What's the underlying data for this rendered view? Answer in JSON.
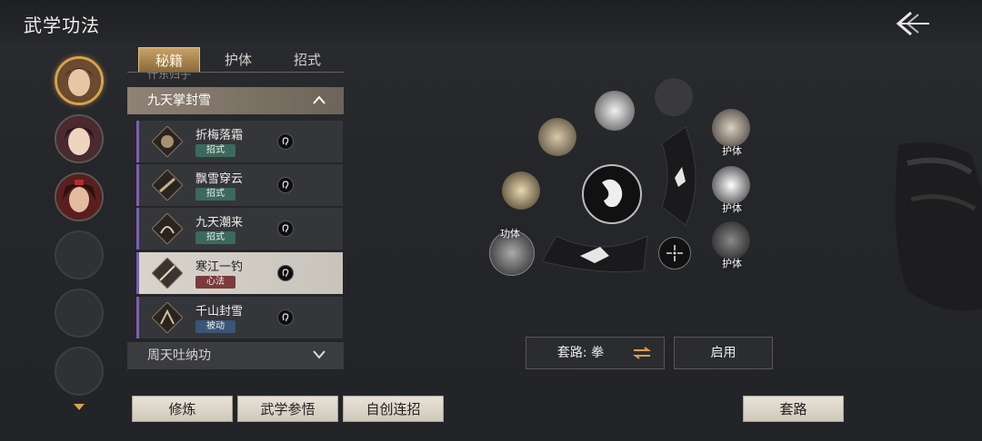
{
  "header": {
    "title": "武学功法"
  },
  "tabs": [
    {
      "label": "秘籍"
    },
    {
      "label": "护体"
    },
    {
      "label": "招式"
    }
  ],
  "list": {
    "cut_row_text": "什东归子",
    "open_category": "九天掌封雪",
    "closed_category": "周天吐纳功",
    "skills": [
      {
        "name": "折梅落霜",
        "tag": "招式"
      },
      {
        "name": "飘雪穿云",
        "tag": "招式"
      },
      {
        "name": "九天潮来",
        "tag": "招式"
      },
      {
        "name": "寒江一钓",
        "tag": "心法"
      },
      {
        "name": "千山封雪",
        "tag": "被动"
      }
    ]
  },
  "wheel": {
    "labels": {
      "hu_ti_1": "护体",
      "hu_ti_2": "护体",
      "hu_ti_3": "护体",
      "gong_ti": "功体"
    }
  },
  "routine": {
    "label": "套路: 拳",
    "enable": "启用"
  },
  "buttons": {
    "practice": "修炼",
    "comprehend": "武学参悟",
    "custom_combo": "自创连招",
    "routine": "套路"
  },
  "colors": {
    "accent_gold": "#d9a24a",
    "skill_bar": "#7d5fb3"
  }
}
